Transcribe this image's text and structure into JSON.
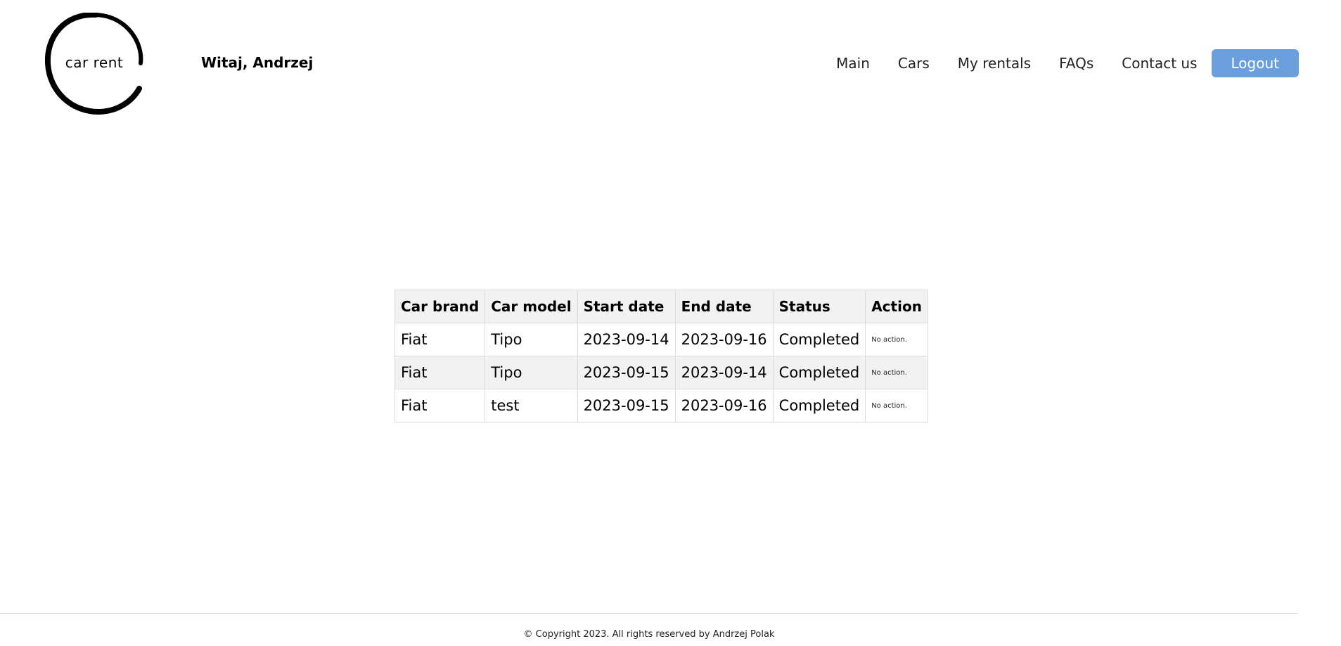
{
  "brand": {
    "logo_text": "car rent"
  },
  "header": {
    "greeting": "Witaj, Andrzej"
  },
  "nav": {
    "items": [
      {
        "label": "Main"
      },
      {
        "label": "Cars"
      },
      {
        "label": "My rentals"
      },
      {
        "label": "FAQs"
      },
      {
        "label": "Contact us"
      }
    ],
    "logout_label": "Logout"
  },
  "rentals": {
    "columns": [
      "Car brand",
      "Car model",
      "Start date",
      "End date",
      "Status",
      "Action"
    ],
    "rows": [
      {
        "brand": "Fiat",
        "model": "Tipo",
        "start": "2023-09-14",
        "end": "2023-09-16",
        "status": "Completed",
        "action": "No action."
      },
      {
        "brand": "Fiat",
        "model": "Tipo",
        "start": "2023-09-15",
        "end": "2023-09-14",
        "status": "Completed",
        "action": "No action."
      },
      {
        "brand": "Fiat",
        "model": "test",
        "start": "2023-09-15",
        "end": "2023-09-16",
        "status": "Completed",
        "action": "No action."
      }
    ]
  },
  "footer": {
    "copyright": "© Copyright 2023. All rights reserved by Andrzej Polak"
  },
  "colors": {
    "logout_button": "#6a9fde",
    "header_row_bg": "#f2f2f2",
    "striped_row_bg": "#f2f2f2",
    "border": "#dcdcdc"
  }
}
